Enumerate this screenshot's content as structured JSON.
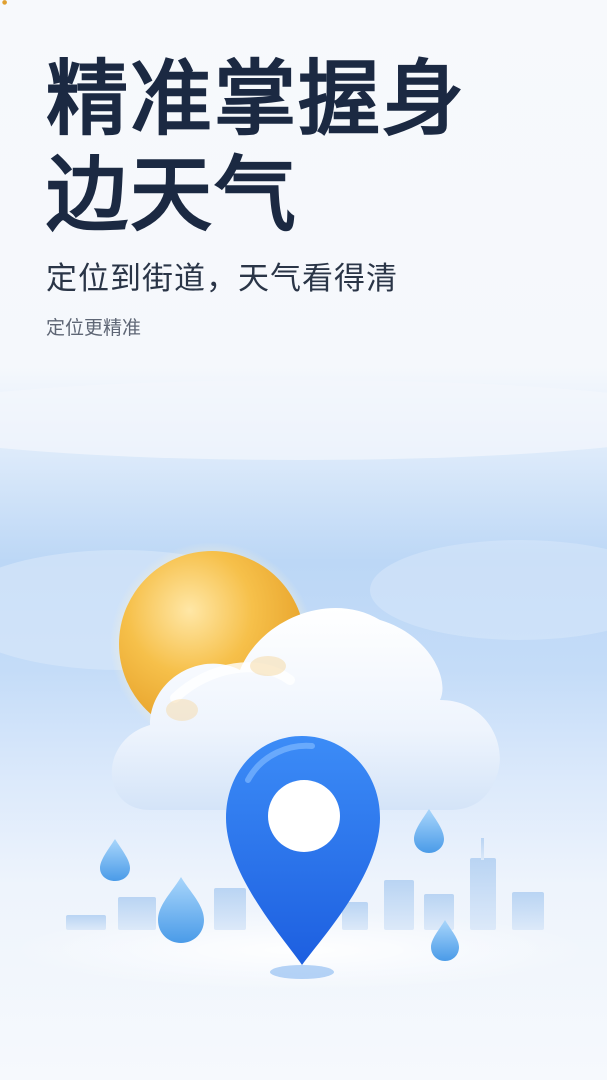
{
  "headline": {
    "line1": "精准掌握身",
    "line2": "边天气"
  },
  "subtitle": "定位到街道，天气看得清",
  "caption": "定位更精准",
  "illustration": {
    "icons": [
      "sun-icon",
      "cloud-icon",
      "location-pin-icon",
      "raindrop-icon",
      "city-skyline-icon"
    ],
    "colors": {
      "sun": "#f2b63a",
      "pin": "#2f7bf0",
      "cloud": "#f4f8fe",
      "sky": "#bcd7f6",
      "drop": "#5aa8ef"
    }
  }
}
